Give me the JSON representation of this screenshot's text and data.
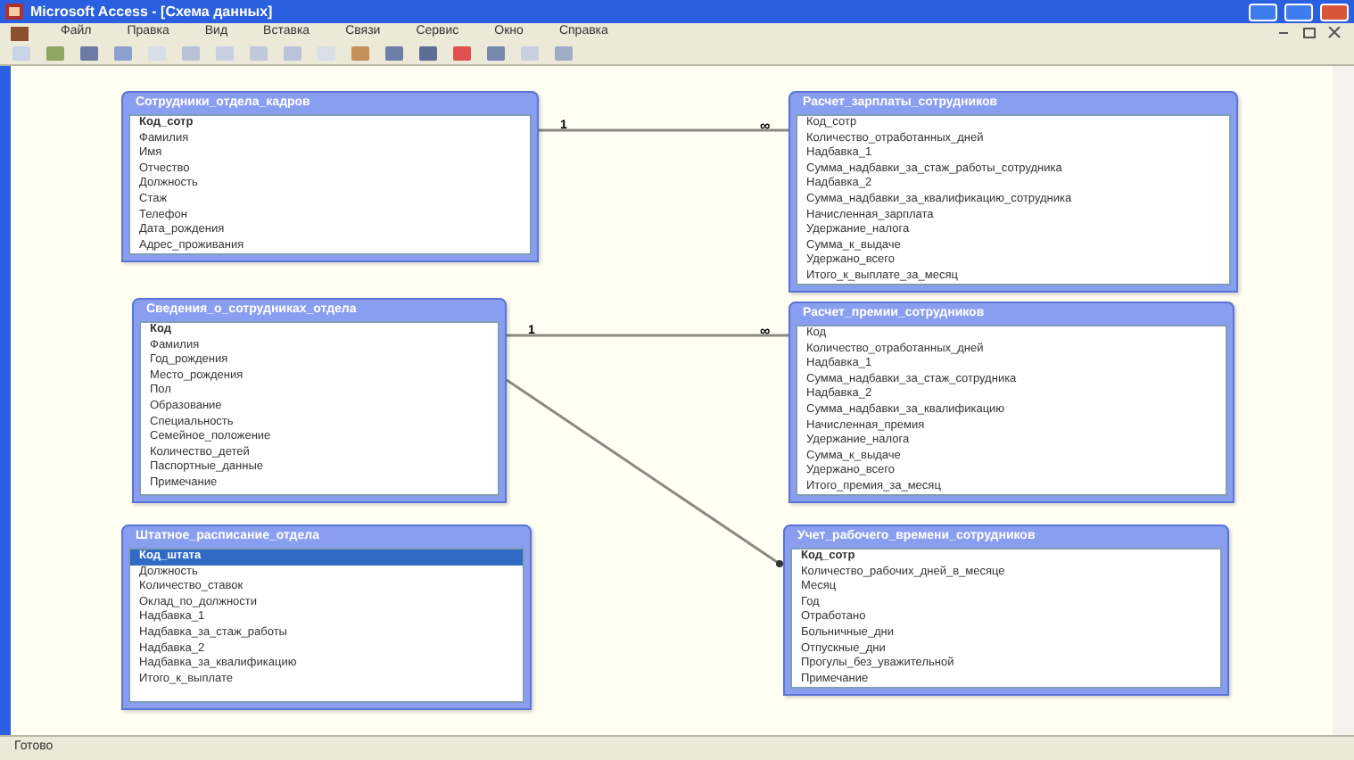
{
  "window": {
    "title": "Microsoft Access - [Схема данных]"
  },
  "menu": [
    "Файл",
    "Правка",
    "Вид",
    "Вставка",
    "Связи",
    "Сервис",
    "Окно",
    "Справка"
  ],
  "tables": [
    {
      "title": "Сотрудники_отдела_кадров",
      "fields": [
        {
          "name": "Код_сотр",
          "key": true,
          "selected": false
        },
        {
          "name": "Фамилия",
          "key": false,
          "selected": false
        },
        {
          "name": "Имя",
          "key": false,
          "selected": false
        },
        {
          "name": "Отчество",
          "key": false,
          "selected": false
        },
        {
          "name": "Должность",
          "key": false,
          "selected": false
        },
        {
          "name": "Стаж",
          "key": false,
          "selected": false
        },
        {
          "name": "Телефон",
          "key": false,
          "selected": false
        },
        {
          "name": "Дата_рождения",
          "key": false,
          "selected": false
        },
        {
          "name": "Адрес_проживания",
          "key": false,
          "selected": false
        }
      ]
    },
    {
      "title": "Сведения_о_сотрудниках_отдела",
      "fields": [
        {
          "name": "Код",
          "key": true,
          "selected": false
        },
        {
          "name": "Фамилия",
          "key": false,
          "selected": false
        },
        {
          "name": "Год_рождения",
          "key": false,
          "selected": false
        },
        {
          "name": "Место_рождения",
          "key": false,
          "selected": false
        },
        {
          "name": "Пол",
          "key": false,
          "selected": false
        },
        {
          "name": "Образование",
          "key": false,
          "selected": false
        },
        {
          "name": "Специальность",
          "key": false,
          "selected": false
        },
        {
          "name": "Семейное_положение",
          "key": false,
          "selected": false
        },
        {
          "name": "Количество_детей",
          "key": false,
          "selected": false
        },
        {
          "name": "Паспортные_данные",
          "key": false,
          "selected": false
        },
        {
          "name": "Примечание",
          "key": false,
          "selected": false
        }
      ]
    },
    {
      "title": "Штатное_расписание_отдела",
      "fields": [
        {
          "name": "Код_штата",
          "key": true,
          "selected": true
        },
        {
          "name": "Должность",
          "key": false,
          "selected": false
        },
        {
          "name": "Количество_ставок",
          "key": false,
          "selected": false
        },
        {
          "name": "Оклад_по_должности",
          "key": false,
          "selected": false
        },
        {
          "name": "Надбавка_1",
          "key": false,
          "selected": false
        },
        {
          "name": "Надбавка_за_стаж_работы",
          "key": false,
          "selected": false
        },
        {
          "name": "Надбавка_2",
          "key": false,
          "selected": false
        },
        {
          "name": "Надбавка_за_квалификацию",
          "key": false,
          "selected": false
        },
        {
          "name": "Итого_к_выплате",
          "key": false,
          "selected": false
        }
      ]
    },
    {
      "title": "Расчет_зарплаты_сотрудников",
      "fields": [
        {
          "name": "Код_сотр",
          "key": false,
          "selected": false
        },
        {
          "name": "Количество_отработанных_дней",
          "key": false,
          "selected": false
        },
        {
          "name": "Надбавка_1",
          "key": false,
          "selected": false
        },
        {
          "name": "Сумма_надбавки_за_стаж_работы_сотрудника",
          "key": false,
          "selected": false
        },
        {
          "name": "Надбавка_2",
          "key": false,
          "selected": false
        },
        {
          "name": "Сумма_надбавки_за_квалификацию_сотрудника",
          "key": false,
          "selected": false
        },
        {
          "name": "Начисленная_зарплата",
          "key": false,
          "selected": false
        },
        {
          "name": "Удержание_налога",
          "key": false,
          "selected": false
        },
        {
          "name": "Сумма_к_выдаче",
          "key": false,
          "selected": false
        },
        {
          "name": "Удержано_всего",
          "key": false,
          "selected": false
        },
        {
          "name": "Итого_к_выплате_за_месяц",
          "key": false,
          "selected": false
        }
      ]
    },
    {
      "title": "Расчет_премии_сотрудников",
      "fields": [
        {
          "name": "Код",
          "key": false,
          "selected": false
        },
        {
          "name": "Количество_отработанных_дней",
          "key": false,
          "selected": false
        },
        {
          "name": "Надбавка_1",
          "key": false,
          "selected": false
        },
        {
          "name": "Сумма_надбавки_за_стаж_сотрудника",
          "key": false,
          "selected": false
        },
        {
          "name": "Надбавка_2",
          "key": false,
          "selected": false
        },
        {
          "name": "Сумма_надбавки_за_квалификацию",
          "key": false,
          "selected": false
        },
        {
          "name": "Начисленная_премия",
          "key": false,
          "selected": false
        },
        {
          "name": "Удержание_налога",
          "key": false,
          "selected": false
        },
        {
          "name": "Сумма_к_выдаче",
          "key": false,
          "selected": false
        },
        {
          "name": "Удержано_всего",
          "key": false,
          "selected": false
        },
        {
          "name": "Итого_премия_за_месяц",
          "key": false,
          "selected": false
        }
      ]
    },
    {
      "title": "Учет_рабочего_времени_сотрудников",
      "fields": [
        {
          "name": "Код_сотр",
          "key": true,
          "selected": false
        },
        {
          "name": "Количество_рабочих_дней_в_месяце",
          "key": false,
          "selected": false
        },
        {
          "name": "Месяц",
          "key": false,
          "selected": false
        },
        {
          "name": "Год",
          "key": false,
          "selected": false
        },
        {
          "name": "Отработано",
          "key": false,
          "selected": false
        },
        {
          "name": "Больничные_дни",
          "key": false,
          "selected": false
        },
        {
          "name": "Отпускные_дни",
          "key": false,
          "selected": false
        },
        {
          "name": "Прогулы_без_уважительной",
          "key": false,
          "selected": false
        },
        {
          "name": "Примечание",
          "key": false,
          "selected": false
        }
      ]
    }
  ],
  "relationships": [
    {
      "kind": "one_to_many",
      "one": "1",
      "many": "∞"
    },
    {
      "kind": "one_to_many",
      "one": "1",
      "many": "∞"
    },
    {
      "kind": "arrow"
    }
  ],
  "status_bar": "Готово"
}
